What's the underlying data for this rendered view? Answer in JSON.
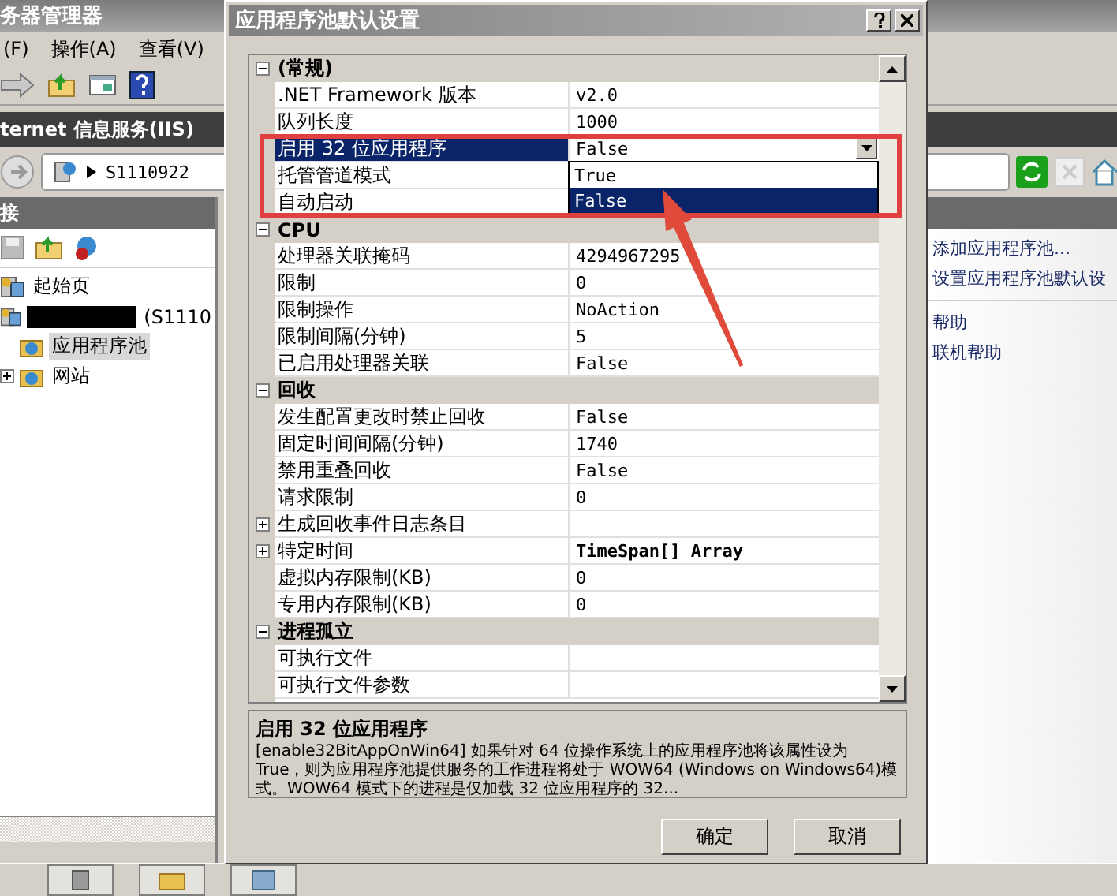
{
  "server_manager": {
    "title": "务器管理器",
    "menu": [
      "(F)",
      "操作(A)",
      "查看(V)"
    ],
    "iis_header": "ternet 信息服务(IIS)",
    "address": "S1110922",
    "connections_title": "接",
    "tree": [
      {
        "label": "起始页",
        "selected": false,
        "redacted": false
      },
      {
        "label": "(S1110",
        "selected": false,
        "redacted": true,
        "children": [
          {
            "label": "应用程序池",
            "selected": true,
            "kind": "pool"
          },
          {
            "label": "网站",
            "selected": false,
            "kind": "folder"
          }
        ]
      }
    ],
    "action_groups": [
      [
        "添加应用程序池...",
        "设置应用程序池默认设"
      ],
      [
        "帮助",
        "联机帮助"
      ]
    ]
  },
  "dialog": {
    "title": "应用程序池默认设置",
    "categories": [
      {
        "name": "(常规)",
        "expanded": true,
        "properties": [
          {
            "name": ".NET Framework 版本",
            "value": "v2.0",
            "kind": "value",
            "selected": false
          },
          {
            "name": "队列长度",
            "value": "1000",
            "kind": "value",
            "selected": false
          },
          {
            "name": "启用 32 位应用程序",
            "value": "False",
            "kind": "value",
            "selected": true,
            "dropdown": [
              {
                "label": "True",
                "selected": false
              },
              {
                "label": "False",
                "selected": true
              }
            ]
          },
          {
            "name": "托管管道模式",
            "kind": "value",
            "selected": false
          },
          {
            "name": "自动启动",
            "kind": "value",
            "selected": false
          }
        ]
      },
      {
        "name": "CPU",
        "expanded": true,
        "properties": [
          {
            "name": "处理器关联掩码",
            "value": "4294967295",
            "kind": "value",
            "selected": false
          },
          {
            "name": "限制",
            "value": "0",
            "kind": "value",
            "selected": false
          },
          {
            "name": "限制操作",
            "value": "NoAction",
            "kind": "value",
            "selected": false
          },
          {
            "name": "限制间隔(分钟)",
            "value": "5",
            "kind": "value",
            "selected": false
          },
          {
            "name": "已启用处理器关联",
            "value": "False",
            "kind": "value",
            "selected": false
          }
        ]
      },
      {
        "name": "回收",
        "expanded": true,
        "properties": [
          {
            "name": "发生配置更改时禁止回收",
            "value": "False",
            "kind": "value",
            "selected": false
          },
          {
            "name": "固定时间间隔(分钟)",
            "value": "1740",
            "kind": "value",
            "selected": false
          },
          {
            "name": "禁用重叠回收",
            "value": "False",
            "kind": "value",
            "selected": false
          },
          {
            "name": "请求限制",
            "value": "0",
            "kind": "value",
            "selected": false
          },
          {
            "name": "生成回收事件日志条目",
            "kind": "group",
            "selected": false
          },
          {
            "name": "特定时间",
            "value": "TimeSpan[] Array",
            "kind": "group",
            "selected": false
          },
          {
            "name": "虚拟内存限制(KB)",
            "value": "0",
            "kind": "value",
            "selected": false
          },
          {
            "name": "专用内存限制(KB)",
            "value": "0",
            "kind": "value",
            "selected": false
          }
        ]
      },
      {
        "name": "进程孤立",
        "expanded": true,
        "properties": [
          {
            "name": "可执行文件",
            "kind": "value",
            "selected": false
          },
          {
            "name": "可执行文件参数",
            "kind": "value",
            "selected": false
          }
        ]
      }
    ],
    "description": {
      "title": "启用 32 位应用程序",
      "text": "[enable32BitAppOnWin64] 如果针对 64 位操作系统上的应用程序池将该属性设为 True，则为应用程序池提供服务的工作进程将处于 WOW64 (Windows on Windows64)模式。WOW64 模式下的进程是仅加载 32 位应用程序的 32..."
    },
    "buttons": [
      "确定",
      "取消"
    ]
  }
}
